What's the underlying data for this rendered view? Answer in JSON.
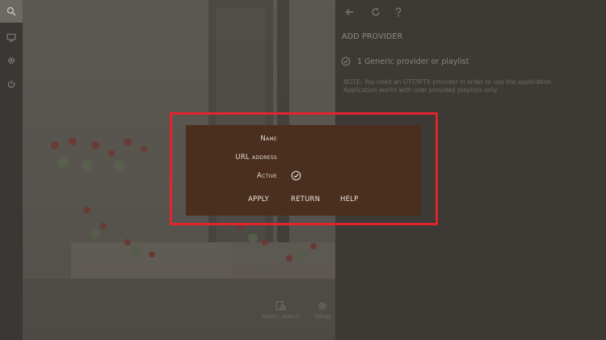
{
  "rail": {
    "items": [
      {
        "icon": "search-icon"
      },
      {
        "icon": "tv-icon"
      },
      {
        "icon": "gear-icon"
      },
      {
        "icon": "power-icon"
      }
    ]
  },
  "topbar": {
    "icons": [
      "back-arrow-icon",
      "refresh-icon",
      "help-icon"
    ]
  },
  "panel": {
    "title": "ADD PROVIDER",
    "provider_label": "1 Generic provider or playlist",
    "note_line1": "NOTE: You need an OTT/IPTV provider in order to use the application.",
    "note_line2": "Application works with user provided playlists only."
  },
  "bottom": {
    "search_label": "Select search",
    "settings_label": "Setup"
  },
  "dialog": {
    "name_label": "Name",
    "url_label": "URL address",
    "active_label": "Active",
    "apply_label": "APPLY",
    "return_label": "RETURN",
    "help_label": "HELP"
  },
  "colors": {
    "dialog_bg": "#4a2e1e",
    "highlight": "#e1242d"
  }
}
